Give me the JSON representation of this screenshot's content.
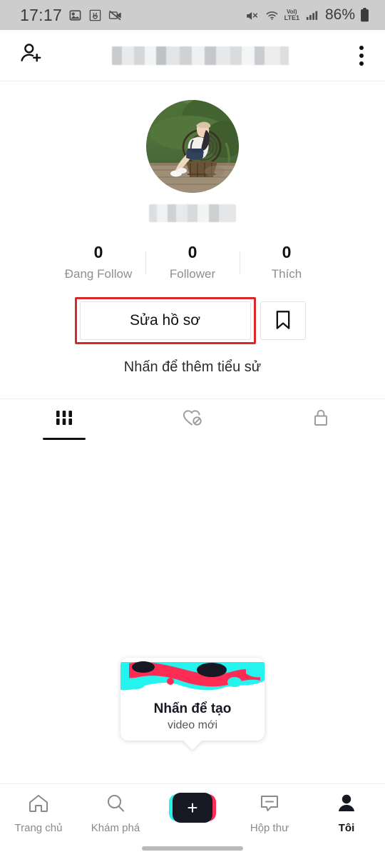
{
  "status_bar": {
    "time": "17:17",
    "battery_text": "86%",
    "network_label": "LTE1",
    "volte_label": "VoI)",
    "icons": [
      "image-icon",
      "peace-hand-icon",
      "camera-off-icon",
      "mute-icon",
      "wifi-icon",
      "volte-icon",
      "signal-icon",
      "battery-icon"
    ]
  },
  "top_bar": {
    "add_friend_icon": "add-person-icon",
    "username_redacted": "",
    "more_icon": "three-dot-menu-icon"
  },
  "profile": {
    "avatar_alt": "woman-sitting-on-rattan-chair",
    "display_name_redacted": "",
    "stats": [
      {
        "value": "0",
        "label": "Đang Follow"
      },
      {
        "value": "0",
        "label": "Follower"
      },
      {
        "value": "0",
        "label": "Thích"
      }
    ],
    "edit_profile_label": "Sửa hồ sơ",
    "bookmark_icon": "bookmark-icon",
    "bio_placeholder": "Nhấn để thêm tiểu sử",
    "highlight_color": "#d8282b"
  },
  "tabs": [
    {
      "name": "videos",
      "icon": "grid-icon",
      "active": true
    },
    {
      "name": "liked",
      "icon": "heart-hidden-icon",
      "active": false
    },
    {
      "name": "private",
      "icon": "lock-icon",
      "active": false
    }
  ],
  "create_card": {
    "title": "Nhấn để tạo",
    "subtitle": "video mới",
    "art_colors": {
      "cyan": "#25f4ee",
      "red": "#fe2c55",
      "black": "#161823"
    }
  },
  "bottom_nav": {
    "items": [
      {
        "label": "Trang chủ",
        "icon": "home-icon",
        "active": false
      },
      {
        "label": "Khám phá",
        "icon": "search-icon",
        "active": false
      },
      {
        "label": "",
        "icon": "create-plus-icon",
        "active": false
      },
      {
        "label": "Hộp thư",
        "icon": "inbox-icon",
        "active": false
      },
      {
        "label": "Tôi",
        "icon": "person-icon",
        "active": true
      }
    ]
  }
}
